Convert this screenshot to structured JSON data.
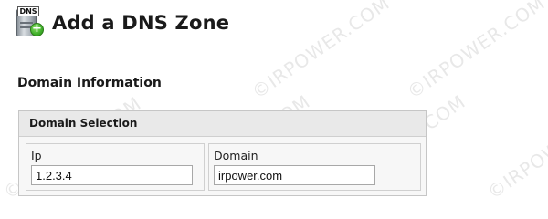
{
  "header": {
    "icon": "dns-add-icon",
    "icon_tag": "DNS",
    "icon_plus": "+",
    "title": "Add a DNS Zone"
  },
  "section": {
    "heading": "Domain Information"
  },
  "panel": {
    "title": "Domain Selection",
    "fields": {
      "ip": {
        "label": "Ip",
        "value": "1.2.3.4"
      },
      "domain": {
        "label": "Domain",
        "value": "irpower.com"
      }
    }
  },
  "watermark": {
    "text": "©IRPOWER.COM"
  },
  "colors": {
    "panel_header_bg": "#e9e9e9",
    "panel_border": "#c6c6c6",
    "icon_plus_green": "#3fae2a"
  }
}
